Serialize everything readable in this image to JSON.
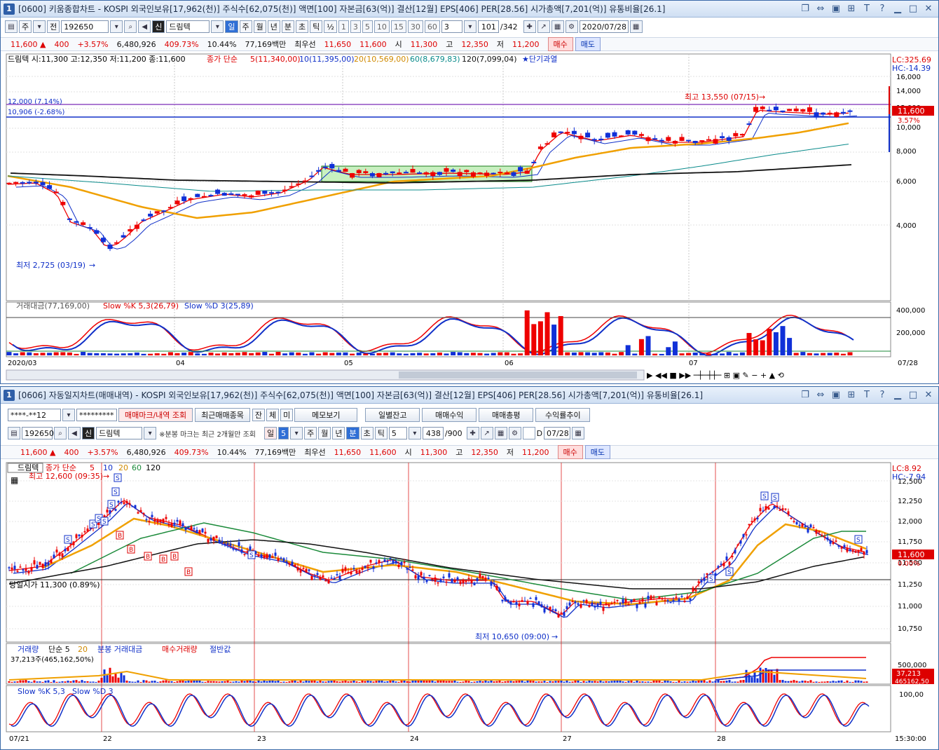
{
  "top": {
    "win_num": "1",
    "title": "[0600] 키움종합차트 - KOSPI 외국인보유[17,962(천)] 주식수[62,075(천)] 액면[100] 자본금[63(억)] 결산[12월] EPS[406] PER[28.56] 시가총액[7,201(억)] 유통비율[26.1]",
    "toolbar": {
      "mode": "주",
      "prev": "전",
      "code": "192650",
      "name_badge": "신",
      "name": "드림텍",
      "periods": [
        "일",
        "주",
        "월",
        "년",
        "분",
        "초",
        "틱"
      ],
      "active_period": "일",
      "ratio": "½",
      "intervals": [
        "1",
        "3",
        "5",
        "10",
        "15",
        "30",
        "60"
      ],
      "interval_sel": "3",
      "count": "101",
      "total": "/342",
      "date": "2020/07/28"
    },
    "quote": {
      "price": "11,600",
      "arrow": "▲",
      "change": "400",
      "pct": "+3.57%",
      "volume": "6,480,926",
      "vol_pct": "409.73%",
      "turnover": "10.44%",
      "amount": "77,169백만",
      "best": "최우선",
      "ask": "11,650",
      "bid": "11,600",
      "open_l": "시",
      "open": "11,300",
      "high_l": "고",
      "high": "12,350",
      "low_l": "저",
      "low": "11,200",
      "buy": "매수",
      "sell": "매도"
    },
    "legend": {
      "name": "드림텍 시:11,300 고:12,350 저:11,200 종:11,600",
      "ma_title": "종가 단순",
      "ma5": "5(11,340,00)",
      "ma10": "10(11,395,00)",
      "ma20": "20(10,569,00)",
      "ma60": "60(8,679,83)",
      "ma120": "120(7,099,04)",
      "signal": "★단기과열"
    },
    "lc": "LC:325.69",
    "hc": "HC:-14.39",
    "price_axis": [
      "16,000",
      "14,000",
      "12,000",
      "10,000",
      "8,000",
      "6,000",
      "4,000"
    ],
    "price_tag": "11,600",
    "pct_tag": "3.57%",
    "line1": "12,000 (7.14%)",
    "line2": "10,906 (-2.68%)",
    "hi_note": "최고 13,550 (07/15)",
    "lo_note": "최저 2,725 (03/19)",
    "sub_legend": {
      "a": "거래대금(77,169,00)",
      "b": "Slow %K 5,3(26,79)",
      "c": "Slow %D 3(25,89)"
    },
    "sub_axis": [
      "400,000",
      "200,000"
    ],
    "x_labels": [
      "2020/03",
      "04",
      "05",
      "06",
      "07"
    ],
    "x_end": "07/28",
    "chart_data": {
      "type": "candlestick",
      "period": "daily",
      "ylim": [
        2000,
        16500
      ],
      "y_scale": "log",
      "high": 13550,
      "high_date": "07/15",
      "low": 2725,
      "low_date": "03/19",
      "last": {
        "open": 11300,
        "high": 12350,
        "low": 11200,
        "close": 11600
      }
    }
  },
  "bottom": {
    "win_num": "1",
    "title": "[0606] 자동일지차트(매매내역) - KOSPI 외국인보유[17,962(천)] 주식수[62,075(천)] 액면[100] 자본금[63(억)] 결산[12월] EPS[406] PER[28.56] 시가총액[7,201(억)] 유통비율[26.1]",
    "row1": {
      "account": "****-**12",
      "pw": "*********",
      "tabs": [
        "매매마크/내역 조회",
        "최근매매종목"
      ],
      "small": [
        "잔",
        "체",
        "미"
      ],
      "memo": "메모보기",
      "buttons": [
        "일별잔고",
        "매매수익",
        "매매총평",
        "수익률추이"
      ]
    },
    "row2": {
      "code": "192650",
      "name_badge": "신",
      "name": "드림텍",
      "note": "※분봉 마크는 최근 2개월만 조회",
      "interval": "5",
      "periods": [
        "주",
        "월",
        "년",
        "분",
        "초",
        "틱"
      ],
      "active_period": "분",
      "tick": "5",
      "count": "438",
      "total": "/900",
      "date_l": "D",
      "date": "07/28"
    },
    "quote": {
      "price": "11,600",
      "arrow": "▲",
      "change": "400",
      "pct": "+3.57%",
      "volume": "6,480,926",
      "vol_pct": "409.73%",
      "turnover": "10.44%",
      "amount": "77,169백만",
      "best": "최우선",
      "ask": "11,650",
      "bid": "11,600",
      "open_l": "시",
      "open": "11,300",
      "high_l": "고",
      "high": "12,350",
      "low_l": "저",
      "low": "11,200",
      "buy": "매수",
      "sell": "매도"
    },
    "legend": {
      "name": "드림텍",
      "ma_title": "종가 단순",
      "p5": "5",
      "p10": "10",
      "p20": "20",
      "p60": "60",
      "p120": "120"
    },
    "lc": "LC:8.92",
    "hc": "HC:-7.94",
    "price_axis": [
      "12,500",
      "12,250",
      "12,000",
      "11,750",
      "11,500",
      "11,250",
      "11,000",
      "10,750"
    ],
    "price_tag": "11,600",
    "pct_tag": "0.00%",
    "prev_close": "당일시가 11,300 (0.89%)",
    "hi_note": "최고 12,600 (09:35)",
    "lo_note": "최저 10,650 (09:00)",
    "vol_legend": {
      "a": "거래량",
      "b": "단순 5",
      "c": "20",
      "d": "분봉 거래대금",
      "e": "매수거래량",
      "f": "절반값"
    },
    "vol_value": "37,213주(465,162,50%)",
    "vol_axis": "500,000",
    "vol_tag1": "37,213",
    "vol_tag2": "465162,50",
    "stoch_legend": {
      "a": "Slow %K 5,3",
      "b": "Slow %D 3"
    },
    "stoch_axis": "100,00",
    "x_labels": [
      "07/21",
      "22",
      "23",
      "24",
      "27",
      "28"
    ],
    "x_end": "15:30:00",
    "chart_data": {
      "type": "candlestick",
      "period": "5min",
      "ylim": [
        10550,
        12620
      ],
      "high": 12600,
      "high_time": "09:35",
      "low": 10650,
      "low_time": "09:00",
      "open": 11300
    }
  }
}
